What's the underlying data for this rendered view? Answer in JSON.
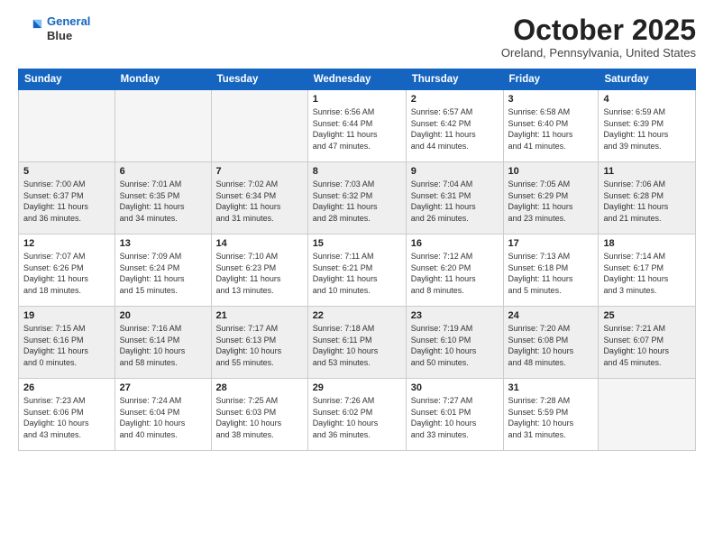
{
  "header": {
    "logo_line1": "General",
    "logo_line2": "Blue",
    "month": "October 2025",
    "location": "Oreland, Pennsylvania, United States"
  },
  "weekdays": [
    "Sunday",
    "Monday",
    "Tuesday",
    "Wednesday",
    "Thursday",
    "Friday",
    "Saturday"
  ],
  "weeks": [
    [
      {
        "day": "",
        "info": ""
      },
      {
        "day": "",
        "info": ""
      },
      {
        "day": "",
        "info": ""
      },
      {
        "day": "1",
        "info": "Sunrise: 6:56 AM\nSunset: 6:44 PM\nDaylight: 11 hours\nand 47 minutes."
      },
      {
        "day": "2",
        "info": "Sunrise: 6:57 AM\nSunset: 6:42 PM\nDaylight: 11 hours\nand 44 minutes."
      },
      {
        "day": "3",
        "info": "Sunrise: 6:58 AM\nSunset: 6:40 PM\nDaylight: 11 hours\nand 41 minutes."
      },
      {
        "day": "4",
        "info": "Sunrise: 6:59 AM\nSunset: 6:39 PM\nDaylight: 11 hours\nand 39 minutes."
      }
    ],
    [
      {
        "day": "5",
        "info": "Sunrise: 7:00 AM\nSunset: 6:37 PM\nDaylight: 11 hours\nand 36 minutes."
      },
      {
        "day": "6",
        "info": "Sunrise: 7:01 AM\nSunset: 6:35 PM\nDaylight: 11 hours\nand 34 minutes."
      },
      {
        "day": "7",
        "info": "Sunrise: 7:02 AM\nSunset: 6:34 PM\nDaylight: 11 hours\nand 31 minutes."
      },
      {
        "day": "8",
        "info": "Sunrise: 7:03 AM\nSunset: 6:32 PM\nDaylight: 11 hours\nand 28 minutes."
      },
      {
        "day": "9",
        "info": "Sunrise: 7:04 AM\nSunset: 6:31 PM\nDaylight: 11 hours\nand 26 minutes."
      },
      {
        "day": "10",
        "info": "Sunrise: 7:05 AM\nSunset: 6:29 PM\nDaylight: 11 hours\nand 23 minutes."
      },
      {
        "day": "11",
        "info": "Sunrise: 7:06 AM\nSunset: 6:28 PM\nDaylight: 11 hours\nand 21 minutes."
      }
    ],
    [
      {
        "day": "12",
        "info": "Sunrise: 7:07 AM\nSunset: 6:26 PM\nDaylight: 11 hours\nand 18 minutes."
      },
      {
        "day": "13",
        "info": "Sunrise: 7:09 AM\nSunset: 6:24 PM\nDaylight: 11 hours\nand 15 minutes."
      },
      {
        "day": "14",
        "info": "Sunrise: 7:10 AM\nSunset: 6:23 PM\nDaylight: 11 hours\nand 13 minutes."
      },
      {
        "day": "15",
        "info": "Sunrise: 7:11 AM\nSunset: 6:21 PM\nDaylight: 11 hours\nand 10 minutes."
      },
      {
        "day": "16",
        "info": "Sunrise: 7:12 AM\nSunset: 6:20 PM\nDaylight: 11 hours\nand 8 minutes."
      },
      {
        "day": "17",
        "info": "Sunrise: 7:13 AM\nSunset: 6:18 PM\nDaylight: 11 hours\nand 5 minutes."
      },
      {
        "day": "18",
        "info": "Sunrise: 7:14 AM\nSunset: 6:17 PM\nDaylight: 11 hours\nand 3 minutes."
      }
    ],
    [
      {
        "day": "19",
        "info": "Sunrise: 7:15 AM\nSunset: 6:16 PM\nDaylight: 11 hours\nand 0 minutes."
      },
      {
        "day": "20",
        "info": "Sunrise: 7:16 AM\nSunset: 6:14 PM\nDaylight: 10 hours\nand 58 minutes."
      },
      {
        "day": "21",
        "info": "Sunrise: 7:17 AM\nSunset: 6:13 PM\nDaylight: 10 hours\nand 55 minutes."
      },
      {
        "day": "22",
        "info": "Sunrise: 7:18 AM\nSunset: 6:11 PM\nDaylight: 10 hours\nand 53 minutes."
      },
      {
        "day": "23",
        "info": "Sunrise: 7:19 AM\nSunset: 6:10 PM\nDaylight: 10 hours\nand 50 minutes."
      },
      {
        "day": "24",
        "info": "Sunrise: 7:20 AM\nSunset: 6:08 PM\nDaylight: 10 hours\nand 48 minutes."
      },
      {
        "day": "25",
        "info": "Sunrise: 7:21 AM\nSunset: 6:07 PM\nDaylight: 10 hours\nand 45 minutes."
      }
    ],
    [
      {
        "day": "26",
        "info": "Sunrise: 7:23 AM\nSunset: 6:06 PM\nDaylight: 10 hours\nand 43 minutes."
      },
      {
        "day": "27",
        "info": "Sunrise: 7:24 AM\nSunset: 6:04 PM\nDaylight: 10 hours\nand 40 minutes."
      },
      {
        "day": "28",
        "info": "Sunrise: 7:25 AM\nSunset: 6:03 PM\nDaylight: 10 hours\nand 38 minutes."
      },
      {
        "day": "29",
        "info": "Sunrise: 7:26 AM\nSunset: 6:02 PM\nDaylight: 10 hours\nand 36 minutes."
      },
      {
        "day": "30",
        "info": "Sunrise: 7:27 AM\nSunset: 6:01 PM\nDaylight: 10 hours\nand 33 minutes."
      },
      {
        "day": "31",
        "info": "Sunrise: 7:28 AM\nSunset: 5:59 PM\nDaylight: 10 hours\nand 31 minutes."
      },
      {
        "day": "",
        "info": ""
      }
    ]
  ]
}
